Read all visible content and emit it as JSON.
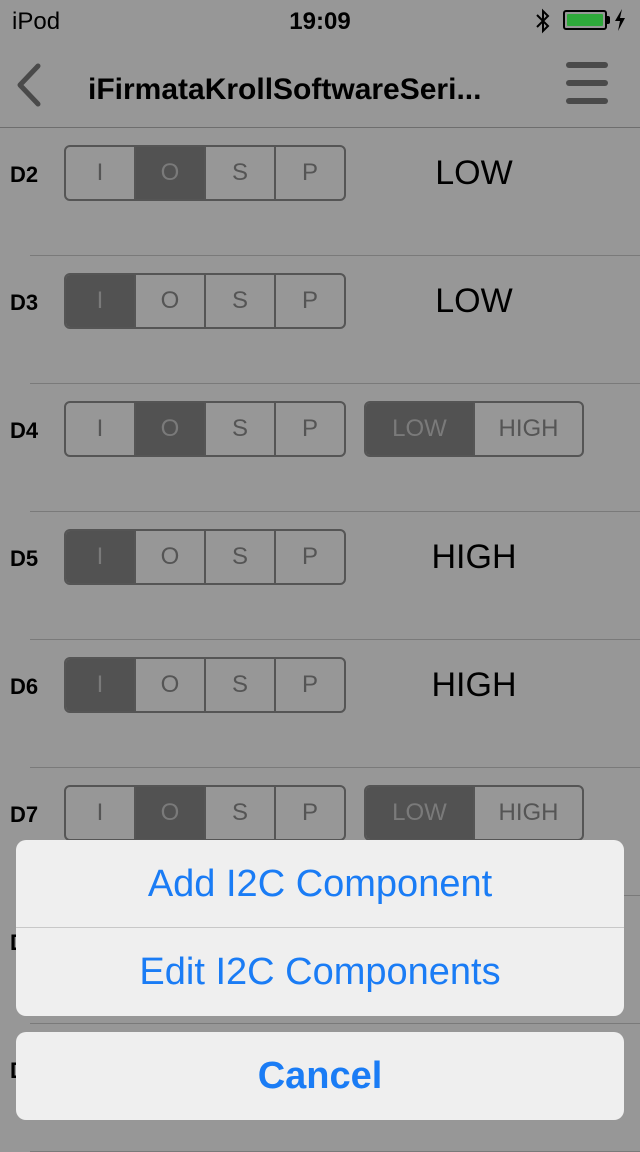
{
  "status_bar": {
    "carrier": "iPod",
    "time": "19:09"
  },
  "nav": {
    "title": "iFirmataKrollSoftwareSeri..."
  },
  "mode_labels": [
    "I",
    "O",
    "S",
    "P"
  ],
  "value_labels": [
    "LOW",
    "HIGH"
  ],
  "pins": [
    {
      "label": "D2",
      "mode": "O",
      "state": "LOW"
    },
    {
      "label": "D3",
      "mode": "I",
      "state": "LOW"
    },
    {
      "label": "D4",
      "mode": "O",
      "state": "LOW",
      "toggle": true
    },
    {
      "label": "D5",
      "mode": "I",
      "state": "HIGH"
    },
    {
      "label": "D6",
      "mode": "I",
      "state": "HIGH"
    },
    {
      "label": "D7",
      "mode": "O",
      "state": "LOW",
      "toggle": true
    },
    {
      "label": "D"
    },
    {
      "label": "D"
    }
  ],
  "action_sheet": {
    "items": [
      "Add I2C Component",
      "Edit I2C Components"
    ],
    "cancel": "Cancel",
    "accent_color": "#1a7cf5"
  }
}
